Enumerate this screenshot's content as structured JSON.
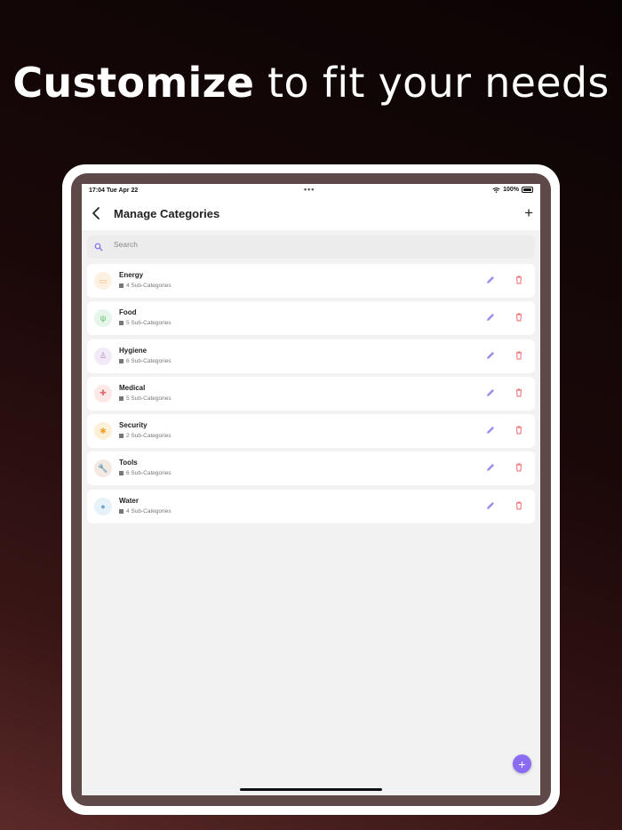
{
  "headline": {
    "bold": "Customize",
    "light": " to fit your needs"
  },
  "status": {
    "time": "17:04  Tue Apr 22",
    "dots": "•••",
    "battery": "100%"
  },
  "nav": {
    "title": "Manage Categories",
    "add_label": "+"
  },
  "search": {
    "placeholder": "Search"
  },
  "categories": [
    {
      "name": "Energy",
      "sub": "4 Sub-Categories",
      "icon": "energy-icon",
      "glyph": "▭",
      "bg": "#fdf1e3",
      "fg": "#f2b36f"
    },
    {
      "name": "Food",
      "sub": "5 Sub-Categories",
      "icon": "food-icon",
      "glyph": "ψ",
      "bg": "#e8f5ea",
      "fg": "#5cbf6b"
    },
    {
      "name": "Hygiene",
      "sub": "6 Sub-Categories",
      "icon": "hygiene-icon",
      "glyph": "♙",
      "bg": "#f3eaf7",
      "fg": "#b58ac9"
    },
    {
      "name": "Medical",
      "sub": "5 Sub-Categories",
      "icon": "medical-icon",
      "glyph": "✚",
      "bg": "#fde8e8",
      "fg": "#e46b6b"
    },
    {
      "name": "Security",
      "sub": "2 Sub-Categories",
      "icon": "security-icon",
      "glyph": "✱",
      "bg": "#fdf0d9",
      "fg": "#f0a12a"
    },
    {
      "name": "Tools",
      "sub": "6 Sub-Categories",
      "icon": "tools-icon",
      "glyph": "🔧",
      "bg": "#f4e9e2",
      "fg": "#8a5a3c"
    },
    {
      "name": "Water",
      "sub": "4 Sub-Categories",
      "icon": "water-icon",
      "glyph": "●",
      "bg": "#e6f1f8",
      "fg": "#6aa6cf"
    }
  ],
  "fab": {
    "label": "+"
  },
  "colors": {
    "accent": "#8a6cf3",
    "delete": "#ef6a6a",
    "edit": "#9b8cf0"
  }
}
